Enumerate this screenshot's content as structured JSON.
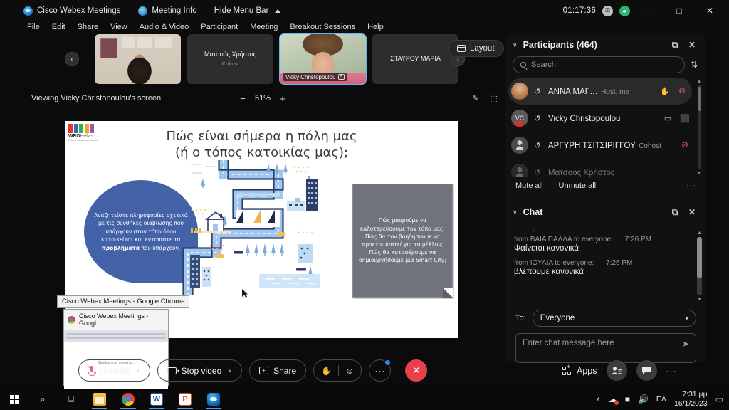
{
  "titlebar": {
    "app_name": "Cisco Webex Meetings",
    "meeting_info": "Meeting Info",
    "hide_menu_bar": "Hide Menu Bar",
    "timer": "01:17:36",
    "key_badge": "⚿",
    "network_badge": "▰",
    "minimize": "─",
    "maximize": "□",
    "close": "✕"
  },
  "menubar": {
    "items": [
      "File",
      "Edit",
      "Share",
      "View",
      "Audio & Video",
      "Participant",
      "Meeting",
      "Breakout Sessions",
      "Help"
    ]
  },
  "filmstrip": {
    "prev_label": "‹",
    "next_label": "›",
    "layout_label": "Layout",
    "thumbs": [
      {
        "name": "",
        "role": "",
        "kind": "video-anna",
        "label": "",
        "active": false
      },
      {
        "name": "Ματσοός Χρήστος",
        "role": "Cohost",
        "kind": "name",
        "label": "",
        "active": false
      },
      {
        "name": "",
        "role": "",
        "kind": "video-vicky",
        "label": "Vicky Christopoulou",
        "active": true
      },
      {
        "name": "ΣΤΑΥΡΟΥ ΜΑΡΙΑ",
        "role": "",
        "kind": "name",
        "label": "",
        "active": false
      }
    ]
  },
  "viewing_bar": {
    "text": "Viewing Vicky Christopoulou's screen",
    "zoom_out": "−",
    "zoom_value": "51%",
    "zoom_in": "+",
    "annotate_icon": "✎",
    "capture_icon": "⬚"
  },
  "slide": {
    "logo_text": "WRO",
    "logo_text_suffix": "Hellas",
    "logo_subtext": "Hellenic Educational Robotics",
    "title_line1": "Πώς είναι σήμερα η πόλη μας",
    "title_line2": "(ή ο τόπος κατοικίας μας);",
    "left_note_pre": "Αναζητείστε πληροφορίες σχετικά με τις συνθήκες διαβίωσης που υπάρχουν στον τόπο όπου κατοικείται και εντοπίστε τα ",
    "left_note_bold": "προβλήματα",
    "left_note_post": " που υπάρχουν.",
    "right_note": "Πώς μπορούμε να καλυτερεύσουμε τον τόπο μας; Πώς θα τον βοηθήσουμε να προετοιμαστεί για το μέλλον; Πώς θα καταφέρουμε να δημιουργήσουμε μια Smart City;"
  },
  "participants": {
    "title": "Participants (464)",
    "collapse_icon": "∨",
    "popout_icon": "⧉",
    "close_icon": "✕",
    "search_placeholder": "Search",
    "sort_icon": "⇅",
    "rows": [
      {
        "name": "ΑΝΝΑ ΜΑΓ…",
        "role": "Host, me",
        "avatar": "photo",
        "hand": "↺",
        "extra_icon": "✋",
        "status_icon": "Ø",
        "status_color": "red",
        "selected": true
      },
      {
        "name": "Vicky Christopoulou",
        "role": "",
        "avatar": "initials",
        "hand": "↺",
        "extra_icon": "▭",
        "status_icon": "⬛",
        "status_color": "green",
        "selected": false
      },
      {
        "name": "ΑΡΓΥΡΗ ΤΣΙΤΣΙΡΙΓΓΟΥ",
        "role": "Cohost",
        "avatar": "generic",
        "hand": "↺",
        "extra_icon": "",
        "status_icon": "Ø",
        "status_color": "red",
        "selected": false
      },
      {
        "name": "Ματσοός Χρήστος",
        "role": "",
        "avatar": "generic",
        "hand": "↺",
        "extra_icon": "",
        "status_icon": "",
        "status_color": "red",
        "selected": false
      }
    ],
    "mute_all": "Mute all",
    "unmute_all": "Unmute all",
    "more": "···",
    "avatar_initials": "VC"
  },
  "chat": {
    "title": "Chat",
    "collapse_icon": "∨",
    "popout_icon": "⧉",
    "close_icon": "✕",
    "messages": [
      {
        "meta": "from ΒΑΙΑ ΠΑΛΛΑ to everyone:",
        "time": "7:26 PM",
        "body": "Φαίνεται κανονικά"
      },
      {
        "meta": "from ΙΟΥΛΙΑ to everyone:",
        "time": "7:26 PM",
        "body": "βλέπουμε κανονικά"
      }
    ],
    "to_label": "To:",
    "to_value": "Everyone",
    "input_placeholder": "Enter chat message here",
    "send_icon": "➤"
  },
  "chrome_popup": {
    "tooltip": "Cisco Webex Meetings - Google Chrome",
    "preview_title": "Cisco Webex Meetings - Googl...",
    "page_text": "Starting your meeting..."
  },
  "controls": {
    "mute_label": "Unmute",
    "video_label": "Stop video",
    "share_label": "Share",
    "reactions_hand": "✋",
    "reactions_emoji": "☺",
    "more_label": "···",
    "end_label": "✕",
    "apps_label": "Apps",
    "participants_icon": "👤",
    "chat_icon": "💬",
    "right_more": "···",
    "chevron": "∨"
  },
  "taskbar": {
    "start": "start-button",
    "search_icon": "⌕",
    "taskview_icon": "⌸",
    "apps": [
      "file-explorer",
      "google-chrome",
      "microsoft-word",
      "microsoft-powerpoint",
      "cisco-webex"
    ],
    "tray_chevron": "∧",
    "language": "ΕΛ",
    "time": "7:31 μμ",
    "date": "16/1/2023",
    "notification_icon": "▭"
  },
  "colors": {
    "accent_blue": "#2f8ae0",
    "end_call_red": "#e8414c",
    "panel_bg": "#111111",
    "slide_note_blue": "#4362a8",
    "slide_note_grey": "#70737c",
    "mic_muted_red": "#e06b78",
    "mic_active_green": "#3fbf7f"
  }
}
